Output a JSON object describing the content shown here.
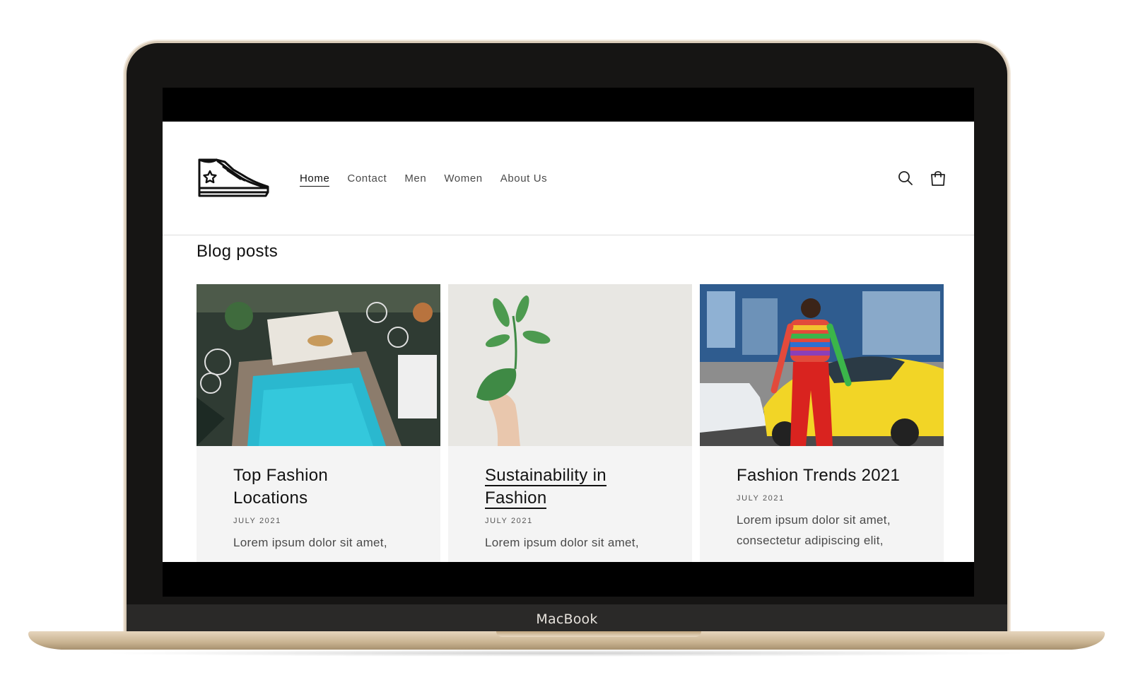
{
  "device": {
    "brand_label": "MacBook"
  },
  "nav": {
    "items": [
      {
        "label": "Home",
        "active": true
      },
      {
        "label": "Contact",
        "active": false
      },
      {
        "label": "Men",
        "active": false
      },
      {
        "label": "Women",
        "active": false
      },
      {
        "label": "About Us",
        "active": false
      }
    ]
  },
  "header": {
    "logo_icon": "sneaker-logo",
    "search_icon": "search-icon",
    "cart_icon": "cart-icon"
  },
  "page": {
    "title": "Blog posts"
  },
  "posts": [
    {
      "title": "Top Fashion Locations",
      "title_lines": [
        "Top Fashion",
        "Locations"
      ],
      "date": "JULY 2021",
      "excerpt": "Lorem ipsum dolor sit amet,",
      "image": "pool-resort-photo"
    },
    {
      "title": "Sustainability in Fashion",
      "title_lines": [
        "Sustainability in",
        "Fashion"
      ],
      "date": "JULY 2021",
      "excerpt": "Lorem ipsum dolor sit amet,",
      "image": "green-plant-hand-photo"
    },
    {
      "title": "Fashion Trends 2021",
      "date": "JULY 2021",
      "excerpt_lines": [
        "Lorem ipsum dolor sit amet,",
        "consectetur adipiscing elit,"
      ],
      "image": "street-fashion-photo"
    }
  ],
  "colors": {
    "text": "#121212",
    "card_bg": "#f4f4f4",
    "frame": "#161514",
    "gold": "#d9cbb8"
  }
}
